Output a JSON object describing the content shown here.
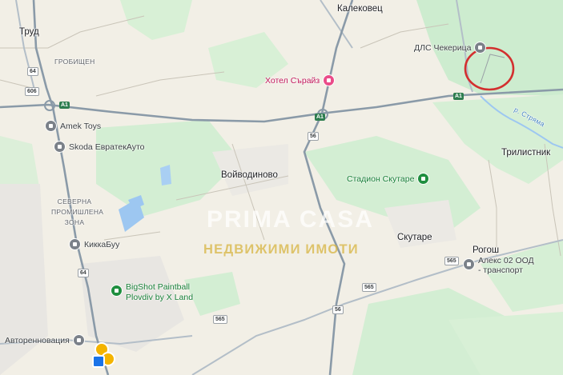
{
  "map": {
    "places": {
      "trud": "Труд",
      "grobishten": "ГРОБИЩЕН",
      "kalekovets": "Калековец",
      "voyvodinovo": "Войводиново",
      "trilistnik": "Трилистник",
      "skutare": "Скутаре",
      "rogosh": "Рогош",
      "severna_line1": "СЕВЕРНА",
      "severna_line2": "ПРОМИШЛЕНА",
      "severna_line3": "ЗОНА"
    },
    "pois": {
      "dls": "ДЛС Чекерица",
      "hotel": "Хотел Сърайз",
      "stadium": "Стадион Скутаре",
      "amek": "Amek Toys",
      "skoda": "Skoda ЕвратекАуто",
      "kikka": "КиккаБуу",
      "bigshot_line1": "BigShot Paintball",
      "bigshot_line2": "Plovdiv by X Land",
      "avtorenovacia": "Авторенновация",
      "aleks_line1": "Алекс 02 ООД",
      "aleks_line2": "- транспорт"
    },
    "road_labels": {
      "a1_west": "A1",
      "a1_center": "A1",
      "a1_east": "A1",
      "r56_north": "56",
      "r56_south": "56",
      "r64_north": "64",
      "r64_south": "64",
      "r606": "606",
      "r565_east": "565",
      "r565_center": "565",
      "r565_west": "565",
      "stream": "р. Стряма"
    },
    "watermark": {
      "brand": "PRIMA CASA",
      "subtitle": "НЕДВИЖИМИ ИМОТИ"
    },
    "colors": {
      "land": "#f2efe6",
      "park": "#cdeccf",
      "water": "#9dc7f1",
      "road": "#8a9aa8",
      "highlight_circle": "#d32f2f"
    }
  }
}
